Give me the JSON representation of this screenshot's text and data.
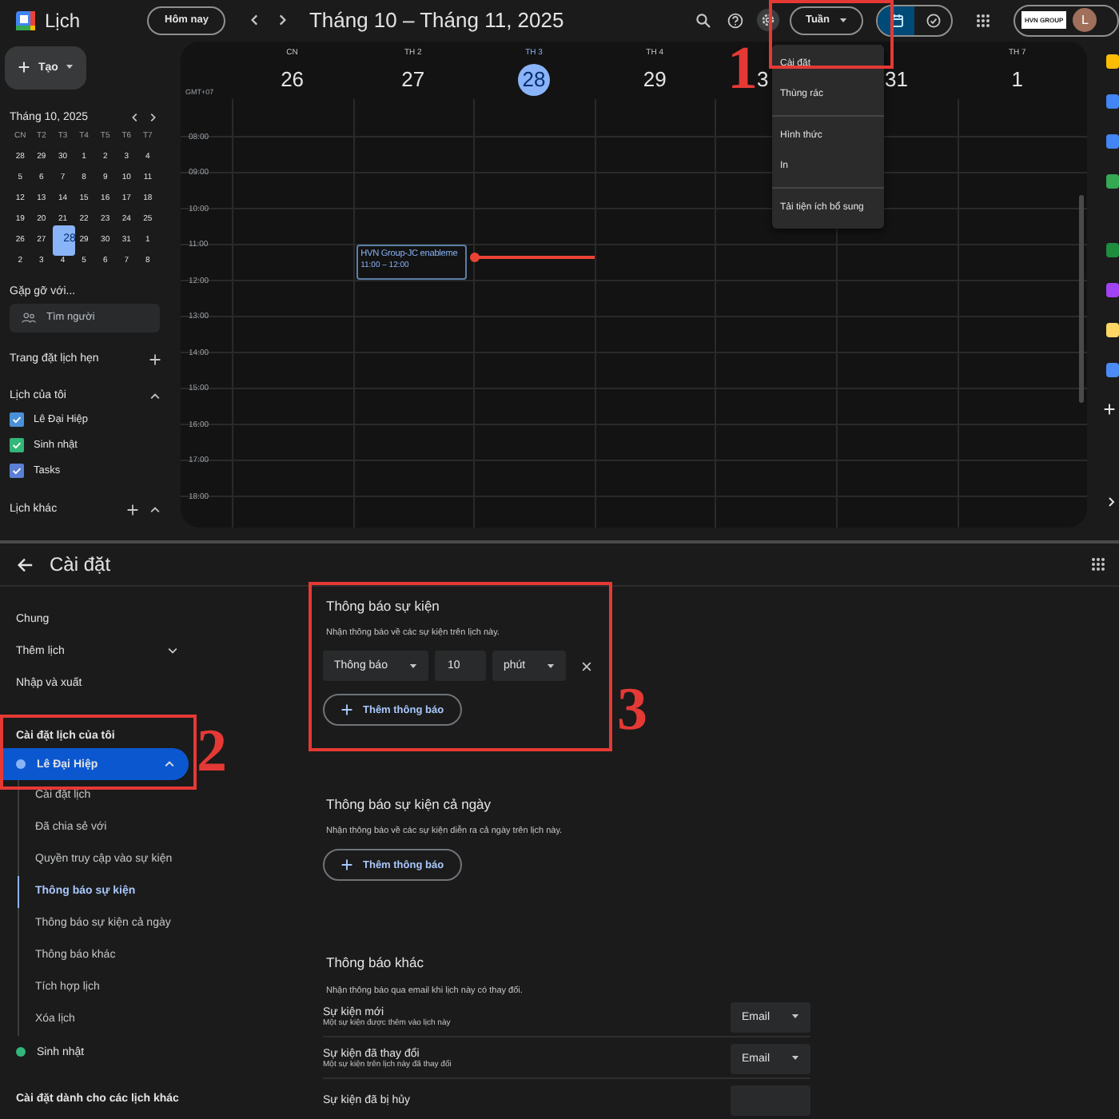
{
  "calendar_app": {
    "app_name": "Lịch",
    "today_button": "Hôm nay",
    "date_range": "Tháng 10 – Tháng 11, 2025",
    "view_button": "Tuần",
    "view_toggle": [
      {
        "kind": "calendar",
        "selected": true
      },
      {
        "kind": "tasks",
        "selected": false
      }
    ],
    "account": {
      "org_logo": "HVN GROUP",
      "avatar": "L"
    },
    "create_button": "Tạo",
    "mini_calendar": {
      "title": "Tháng 10, 2025",
      "weekdays": [
        "CN",
        "T2",
        "T3",
        "T4",
        "T5",
        "T6",
        "T7"
      ],
      "weeks": [
        [
          {
            "day": "28",
            "selected": false
          },
          {
            "day": "29",
            "selected": false
          },
          {
            "day": "30",
            "selected": false
          },
          {
            "day": "1",
            "selected": false
          },
          {
            "day": "2",
            "selected": false
          },
          {
            "day": "3",
            "selected": false
          },
          {
            "day": "4",
            "selected": false
          }
        ],
        [
          {
            "day": "5",
            "selected": false
          },
          {
            "day": "6",
            "selected": false
          },
          {
            "day": "7",
            "selected": false
          },
          {
            "day": "8",
            "selected": false
          },
          {
            "day": "9",
            "selected": false
          },
          {
            "day": "10",
            "selected": false
          },
          {
            "day": "11",
            "selected": false
          }
        ],
        [
          {
            "day": "12",
            "selected": false
          },
          {
            "day": "13",
            "selected": false
          },
          {
            "day": "14",
            "selected": false
          },
          {
            "day": "15",
            "selected": false
          },
          {
            "day": "16",
            "selected": false
          },
          {
            "day": "17",
            "selected": false
          },
          {
            "day": "18",
            "selected": false
          }
        ],
        [
          {
            "day": "19",
            "selected": false
          },
          {
            "day": "20",
            "selected": false
          },
          {
            "day": "21",
            "selected": false
          },
          {
            "day": "22",
            "selected": false
          },
          {
            "day": "23",
            "selected": false
          },
          {
            "day": "24",
            "selected": false
          },
          {
            "day": "25",
            "selected": false
          }
        ],
        [
          {
            "day": "26",
            "selected": false
          },
          {
            "day": "27",
            "selected": false
          },
          {
            "day": "28",
            "selected": true
          },
          {
            "day": "29",
            "selected": false
          },
          {
            "day": "30",
            "selected": false
          },
          {
            "day": "31",
            "selected": false
          },
          {
            "day": "1",
            "selected": false
          }
        ],
        [
          {
            "day": "2",
            "selected": false
          },
          {
            "day": "3",
            "selected": false
          },
          {
            "day": "4",
            "selected": false
          },
          {
            "day": "5",
            "selected": false
          },
          {
            "day": "6",
            "selected": false
          },
          {
            "day": "7",
            "selected": false
          },
          {
            "day": "8",
            "selected": false
          }
        ]
      ]
    },
    "meet_with": {
      "title": "Gặp gỡ với...",
      "placeholder": "Tìm người"
    },
    "booking": "Trang đặt lịch hẹn",
    "my_calendars": {
      "title": "Lịch của tôi",
      "expanded": true,
      "items": [
        {
          "name": "Lê Đại Hiệp",
          "checked": true,
          "color": "#4a90d9"
        },
        {
          "name": "Sinh nhật",
          "checked": true,
          "color": "#33b679"
        },
        {
          "name": "Tasks",
          "checked": true,
          "color": "#5b7fd6"
        }
      ]
    },
    "other_calendars": {
      "title": "Lịch khác",
      "expanded": true
    },
    "timezone": "GMT+07",
    "days": [
      {
        "weekday": "CN",
        "date": "26",
        "today": false
      },
      {
        "weekday": "TH 2",
        "date": "27",
        "today": false,
        "events": [
          {
            "title": "HVN Group-JC enableme",
            "time": "11:00 – 12:00"
          }
        ]
      },
      {
        "weekday": "TH 3",
        "date": "28",
        "today": true
      },
      {
        "weekday": "TH 4",
        "date": "29",
        "today": false
      },
      {
        "date": "3",
        "today": false
      },
      {
        "date": "31",
        "today": false
      },
      {
        "weekday": "TH 7",
        "date": "1",
        "today": false
      }
    ],
    "hours": [
      "08:00",
      "09:00",
      "10:00",
      "11:00",
      "12:00",
      "13:00",
      "14:00",
      "15:00",
      "16:00",
      "17:00",
      "18:00"
    ],
    "settings_menu": [
      [
        "Cài đặt",
        "Thùng rác"
      ],
      [
        "Hình thức",
        "In"
      ],
      [
        "Tải tiện ích bổ sung"
      ]
    ]
  },
  "settings": {
    "title": "Cài đặt",
    "nav_top": [
      {
        "label": "Chung"
      },
      {
        "label": "Thêm lịch",
        "expanded": false
      },
      {
        "label": "Nhập và xuất"
      }
    ],
    "my_settings": {
      "title": "Cài đặt lịch của tôi",
      "calendars": [
        {
          "name": "Lê Đại Hiệp",
          "color": "#8ab4f8",
          "selected": true,
          "expanded": true,
          "children": [
            {
              "label": "Cài đặt lịch",
              "selected": false
            },
            {
              "label": "Đã chia sẻ với",
              "selected": false
            },
            {
              "label": "Quyền truy cập vào sự kiện",
              "selected": false
            },
            {
              "label": "Thông báo sự kiện",
              "selected": true
            },
            {
              "label": "Thông báo sự kiện cả ngày",
              "selected": false
            },
            {
              "label": "Thông báo khác",
              "selected": false
            },
            {
              "label": "Tích hợp lịch",
              "selected": false
            },
            {
              "label": "Xóa lịch",
              "selected": false
            }
          ]
        },
        {
          "name": "Sinh nhật",
          "color": "#33b679",
          "selected": false
        }
      ]
    },
    "other_settings_title": "Cài đặt dành cho các lịch khác",
    "sections": [
      {
        "kind": "reminders",
        "title": "Thông báo sự kiện",
        "description": "Nhận thông báo về các sự kiện trên lịch này.",
        "reminders": [
          {
            "type": "Thông báo",
            "amount": "10",
            "unit": "phút"
          }
        ],
        "add_button": "Thêm thông báo"
      },
      {
        "kind": "reminders",
        "title": "Thông báo sự kiện cả ngày",
        "description": "Nhận thông báo về các sự kiện diễn ra cả ngày trên lịch này.",
        "add_button": "Thêm thông báo"
      },
      {
        "kind": "email",
        "title": "Thông báo khác",
        "description": "Nhận thông báo qua email khi lịch này có thay đổi.",
        "rows": [
          {
            "title": "Sự kiện mới",
            "description": "Một sự kiện được thêm vào lịch này",
            "value": "Email"
          },
          {
            "title": "Sự kiện đã thay đổi",
            "description": "Một sự kiện trên lịch này đã thay đổi",
            "value": "Email"
          },
          {
            "title": "Sự kiện đã bị hủy"
          }
        ]
      }
    ]
  },
  "annotations": [
    "1",
    "2",
    "3"
  ]
}
